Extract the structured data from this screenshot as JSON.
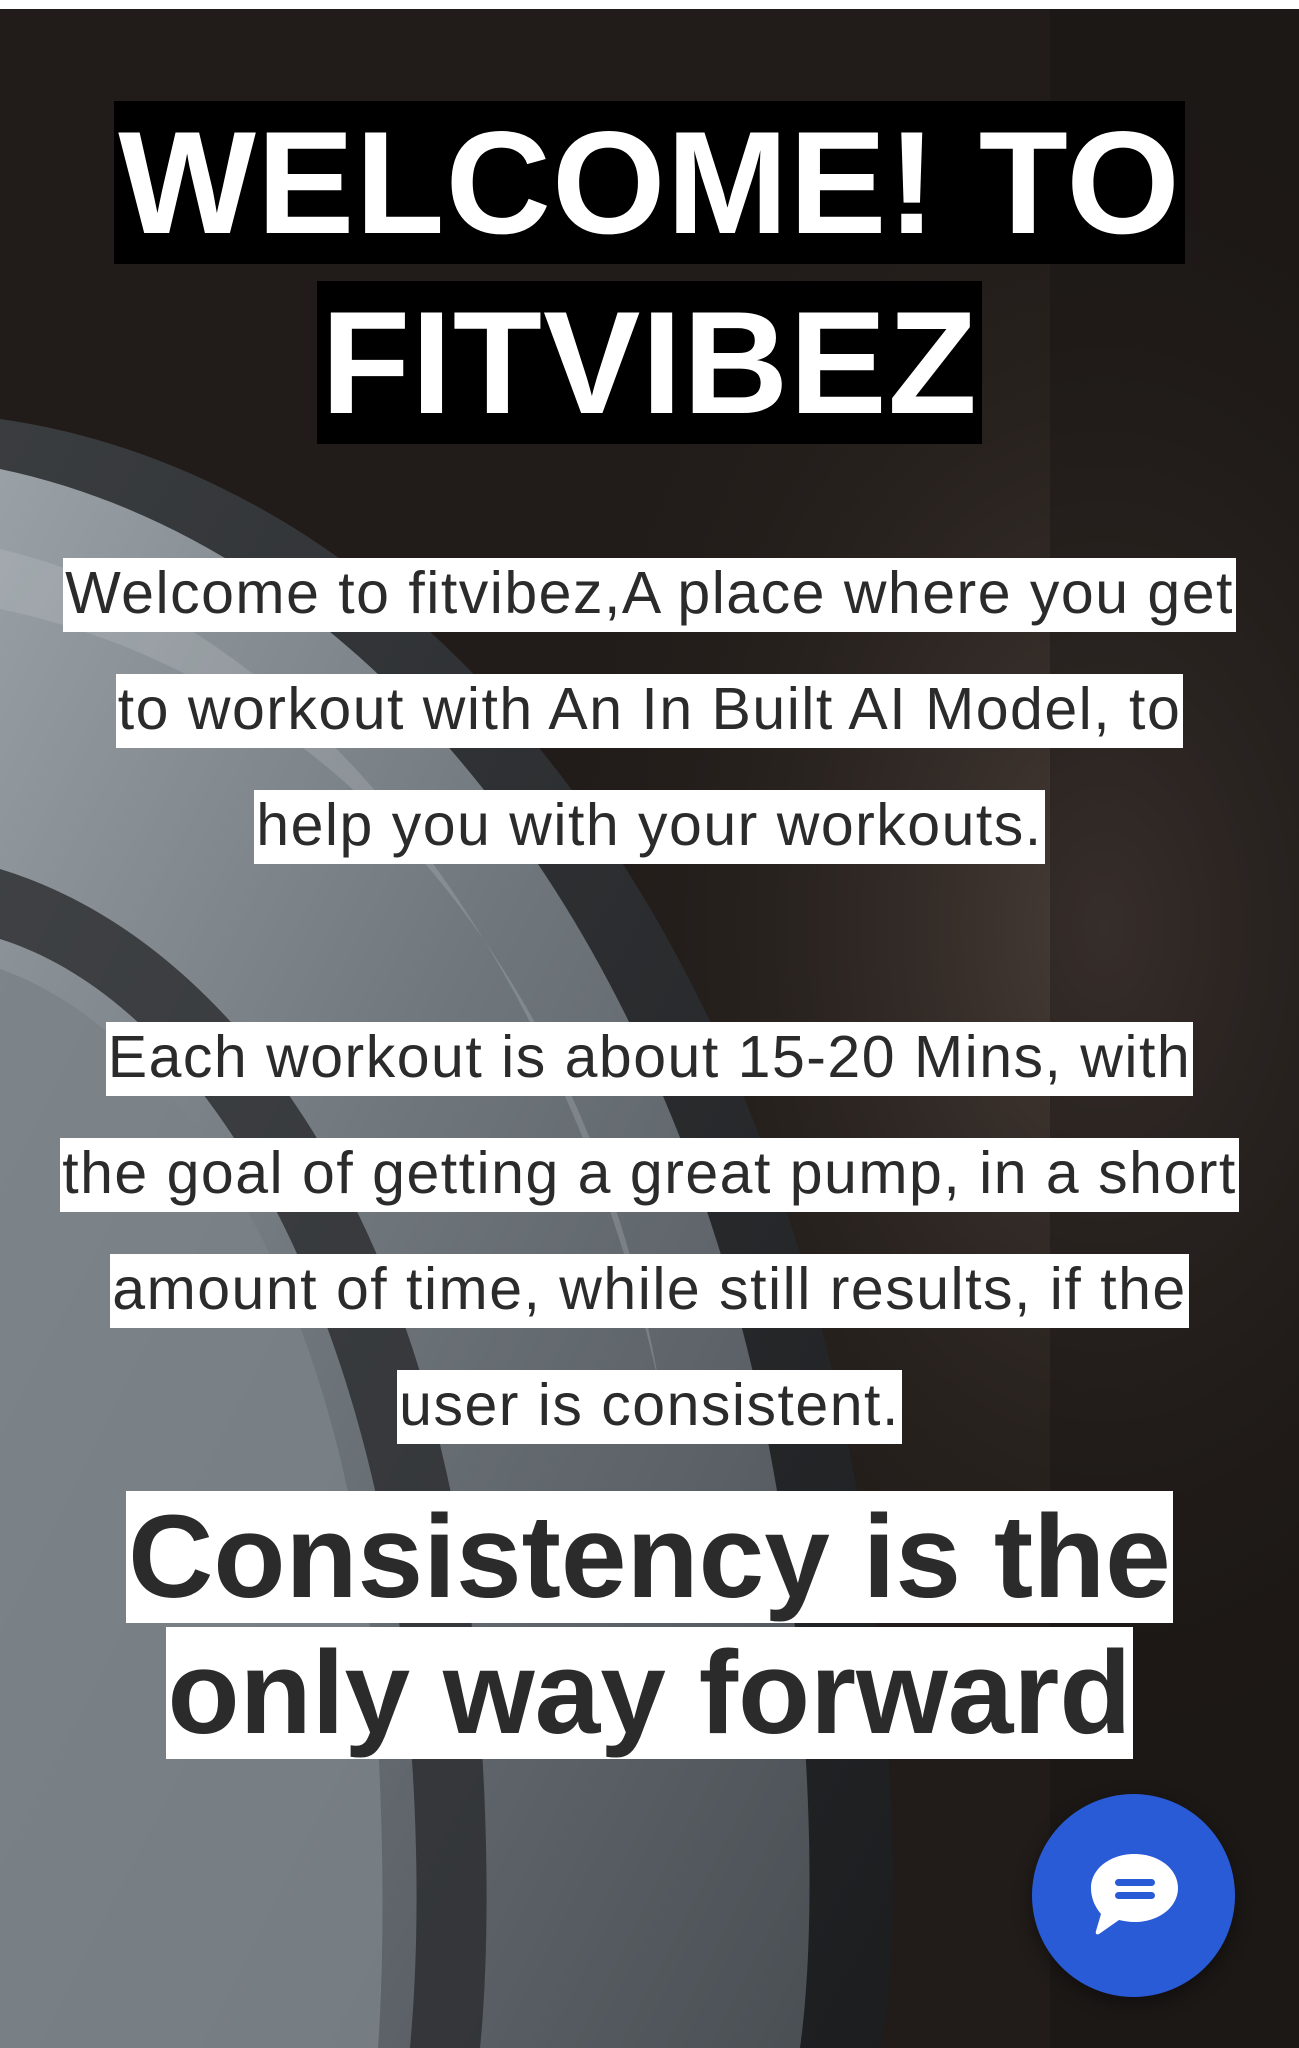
{
  "hero": {
    "title": "WELCOME! TO FITVIBEZ",
    "intro": "Welcome to fitvibez,A place where you get to workout with An In Built AI Model, to help you with your workouts.",
    "details": "Each workout is about 15-20 Mins, with the goal of getting a great pump, in a short amount of time, while still results, if the user is consistent.",
    "tagline": "Consistency is the only way forward"
  },
  "chat": {
    "icon": "chat-bubble-icon",
    "button_color": "#2a5bd7"
  },
  "colors": {
    "title_highlight": "#000000",
    "text_highlight": "#ffffff",
    "body_text": "#2b2b2b"
  }
}
